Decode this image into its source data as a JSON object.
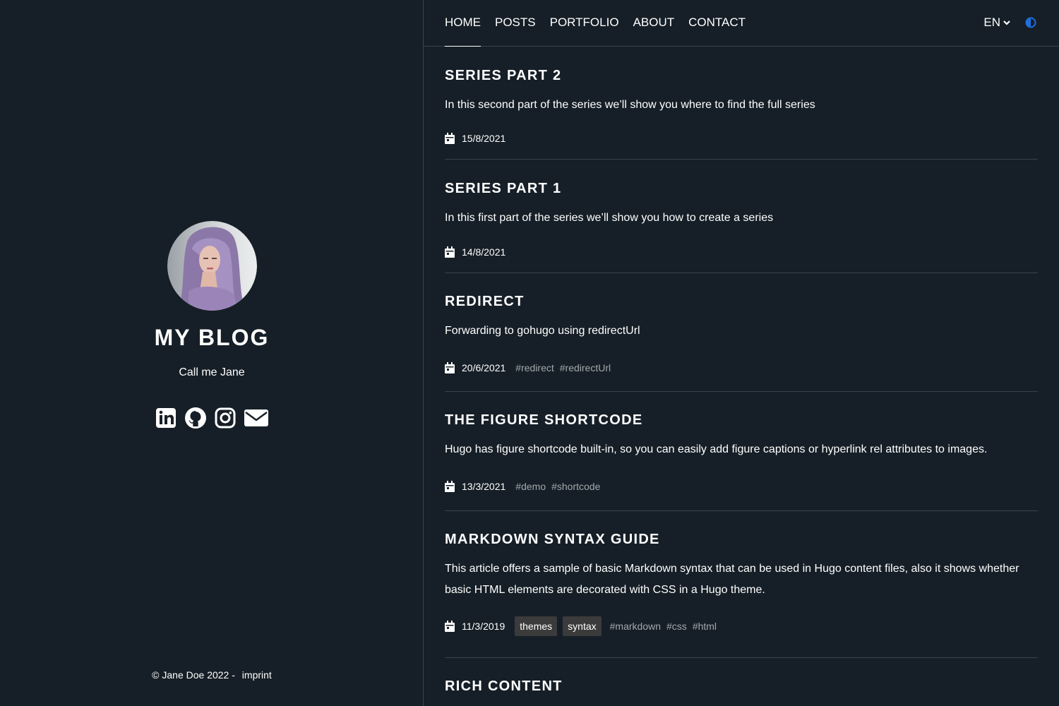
{
  "sidebar": {
    "title": "MY BLOG",
    "tagline": "Call me Jane",
    "socials": [
      {
        "icon": "linkedin-icon"
      },
      {
        "icon": "github-icon"
      },
      {
        "icon": "instagram-icon"
      },
      {
        "icon": "envelope-icon"
      }
    ],
    "footer": {
      "copyright": "© Jane Doe 2022 -",
      "imprint": "imprint"
    }
  },
  "nav": {
    "items": [
      {
        "label": "HOME",
        "active": true
      },
      {
        "label": "POSTS"
      },
      {
        "label": "PORTFOLIO"
      },
      {
        "label": "ABOUT"
      },
      {
        "label": "CONTACT"
      }
    ],
    "language": "EN",
    "theme_toggle_color": "#1e6fe0"
  },
  "posts": [
    {
      "title": "SERIES PART 2",
      "summary": "In this second part of the series we’ll show you where to find the full series",
      "date": "15/8/2021",
      "categories": [],
      "tags": []
    },
    {
      "title": "SERIES PART 1",
      "summary": "In this first part of the series we’ll show you how to create a series",
      "date": "14/8/2021",
      "categories": [],
      "tags": []
    },
    {
      "title": "REDIRECT",
      "summary": "Forwarding to gohugo using redirectUrl",
      "date": "20/6/2021",
      "categories": [],
      "tags": [
        "#redirect",
        "#redirectUrl"
      ]
    },
    {
      "title": "THE FIGURE SHORTCODE",
      "summary": "Hugo has figure shortcode built-in, so you can easily add figure captions or hyperlink rel attributes to images.",
      "date": "13/3/2021",
      "categories": [],
      "tags": [
        "#demo",
        "#shortcode"
      ]
    },
    {
      "title": "MARKDOWN SYNTAX GUIDE",
      "summary": "This article offers a sample of basic Markdown syntax that can be used in Hugo content files, also it shows whether basic HTML elements are decorated with CSS in a Hugo theme.",
      "date": "11/3/2019",
      "categories": [
        "themes",
        "syntax"
      ],
      "tags": [
        "#markdown",
        "#css",
        "#html"
      ]
    },
    {
      "title": "RICH CONTENT",
      "summary": "",
      "date": "",
      "categories": [],
      "tags": []
    }
  ]
}
